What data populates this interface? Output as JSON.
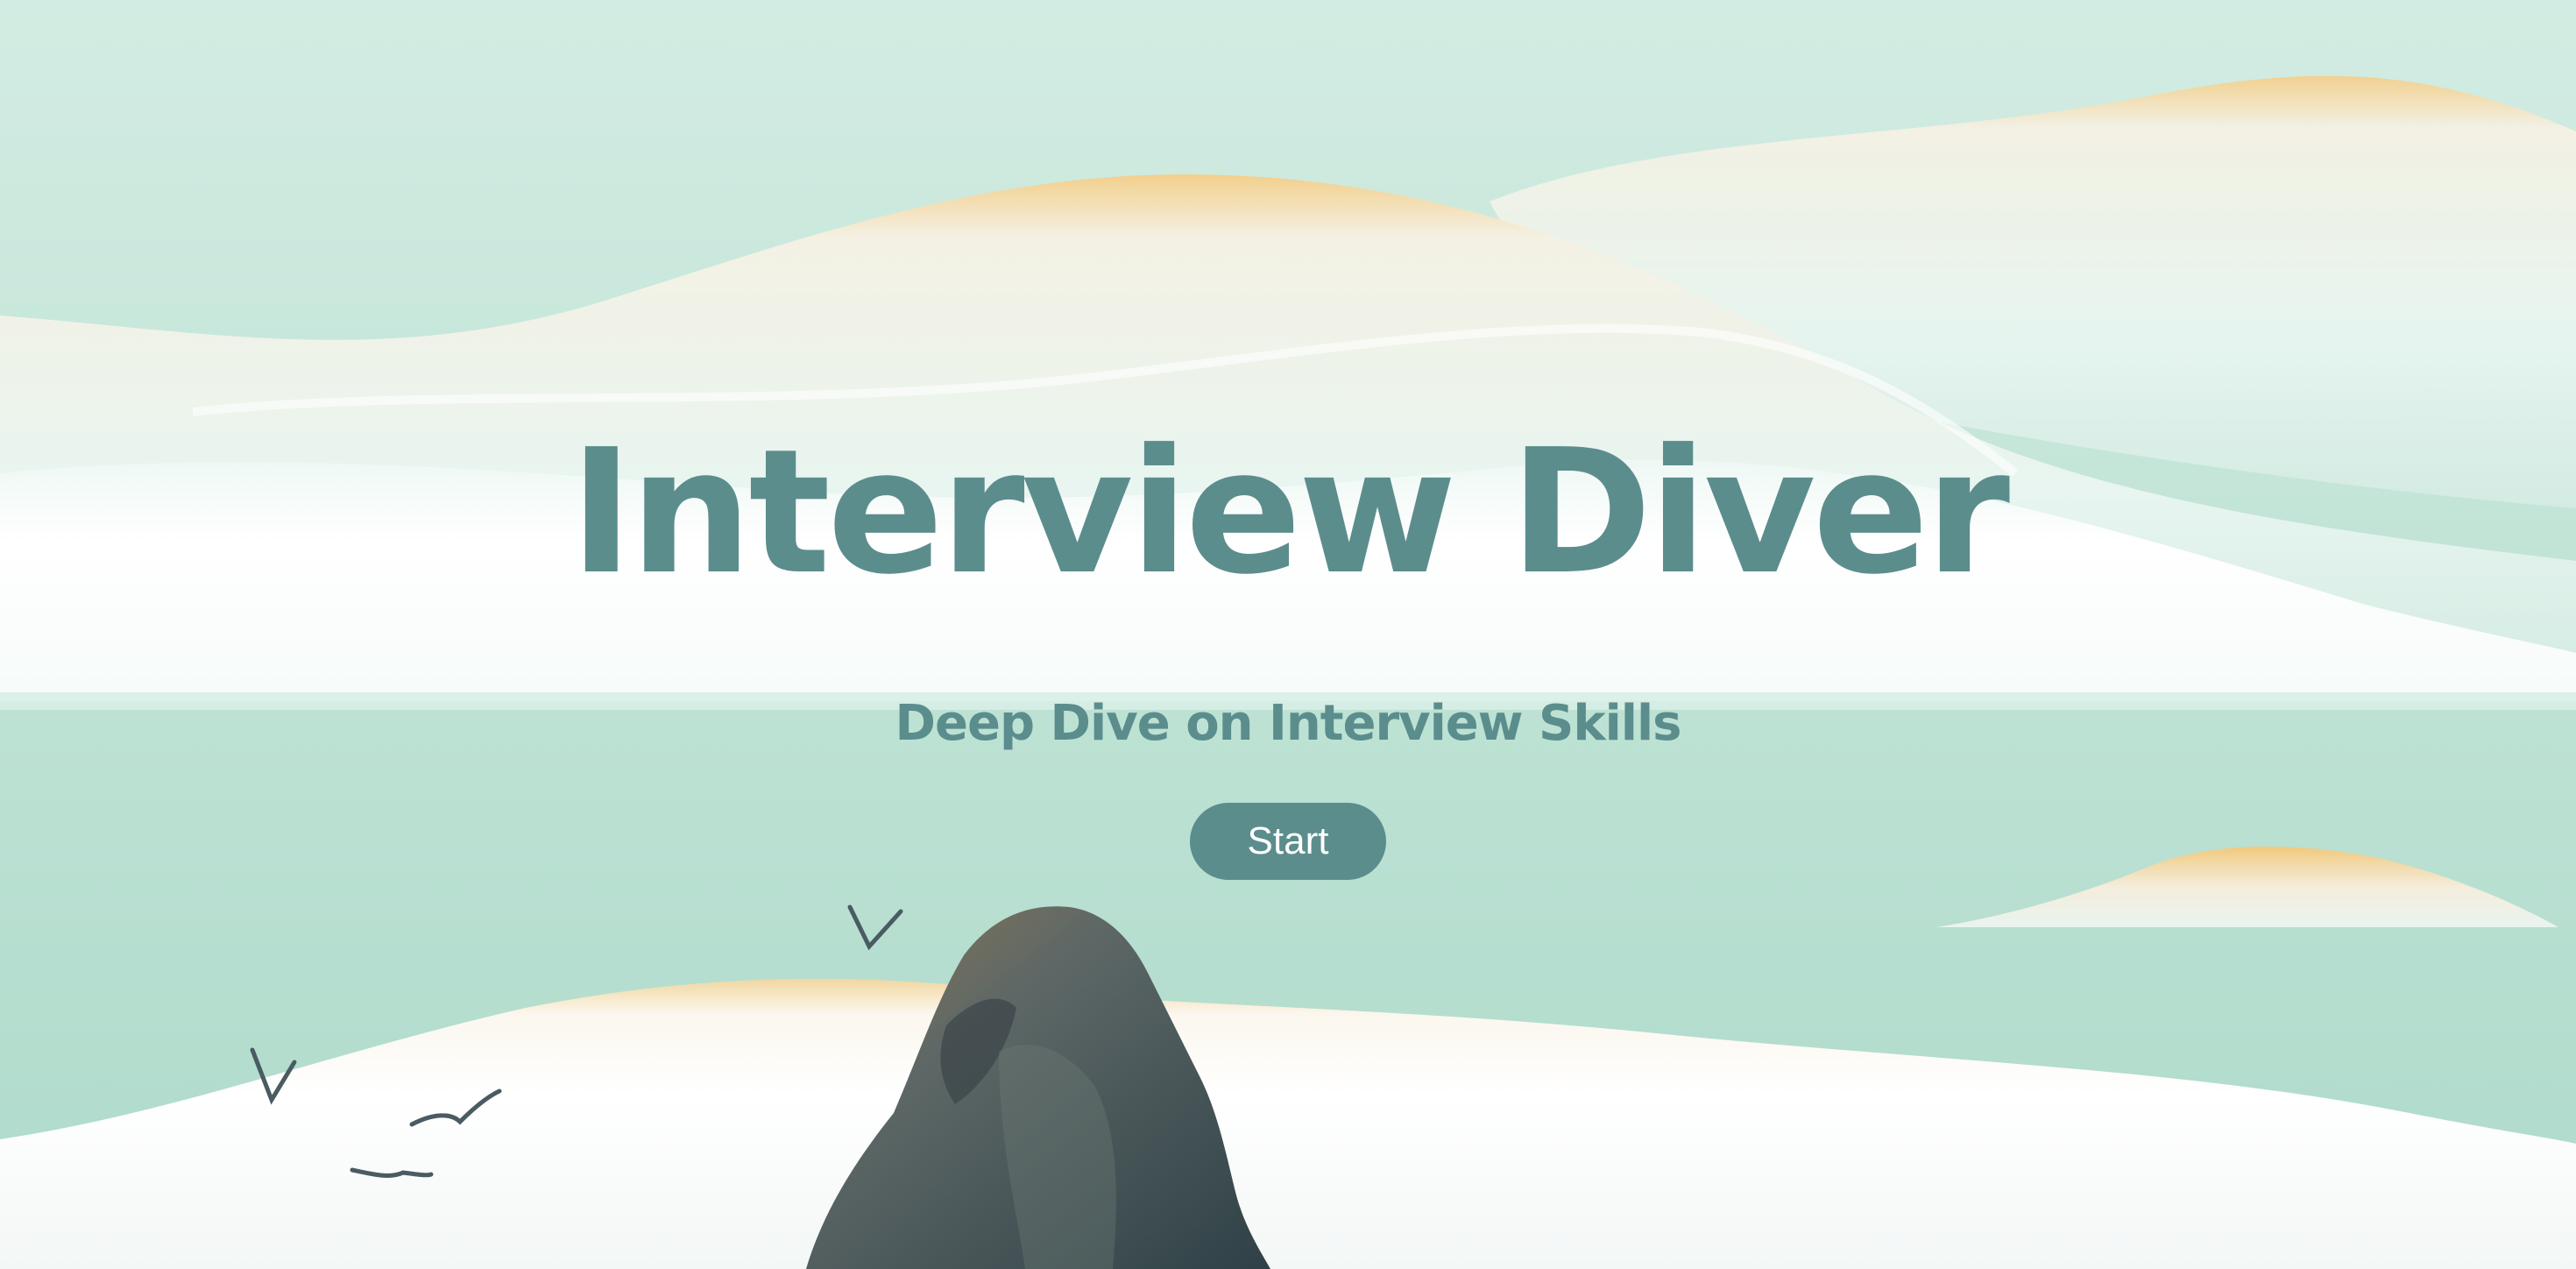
{
  "hero": {
    "title": "Interview Diver",
    "subtitle": "Deep Dive on Interview Skills",
    "start_label": "Start"
  },
  "colors": {
    "brand": "#5c8d8d",
    "sea": "#bfe3d6",
    "sand_highlight": "#f0c878",
    "rock": "#4b5a5c"
  },
  "icons": {
    "birds": "bird-icon",
    "rock": "rock-illustration"
  }
}
